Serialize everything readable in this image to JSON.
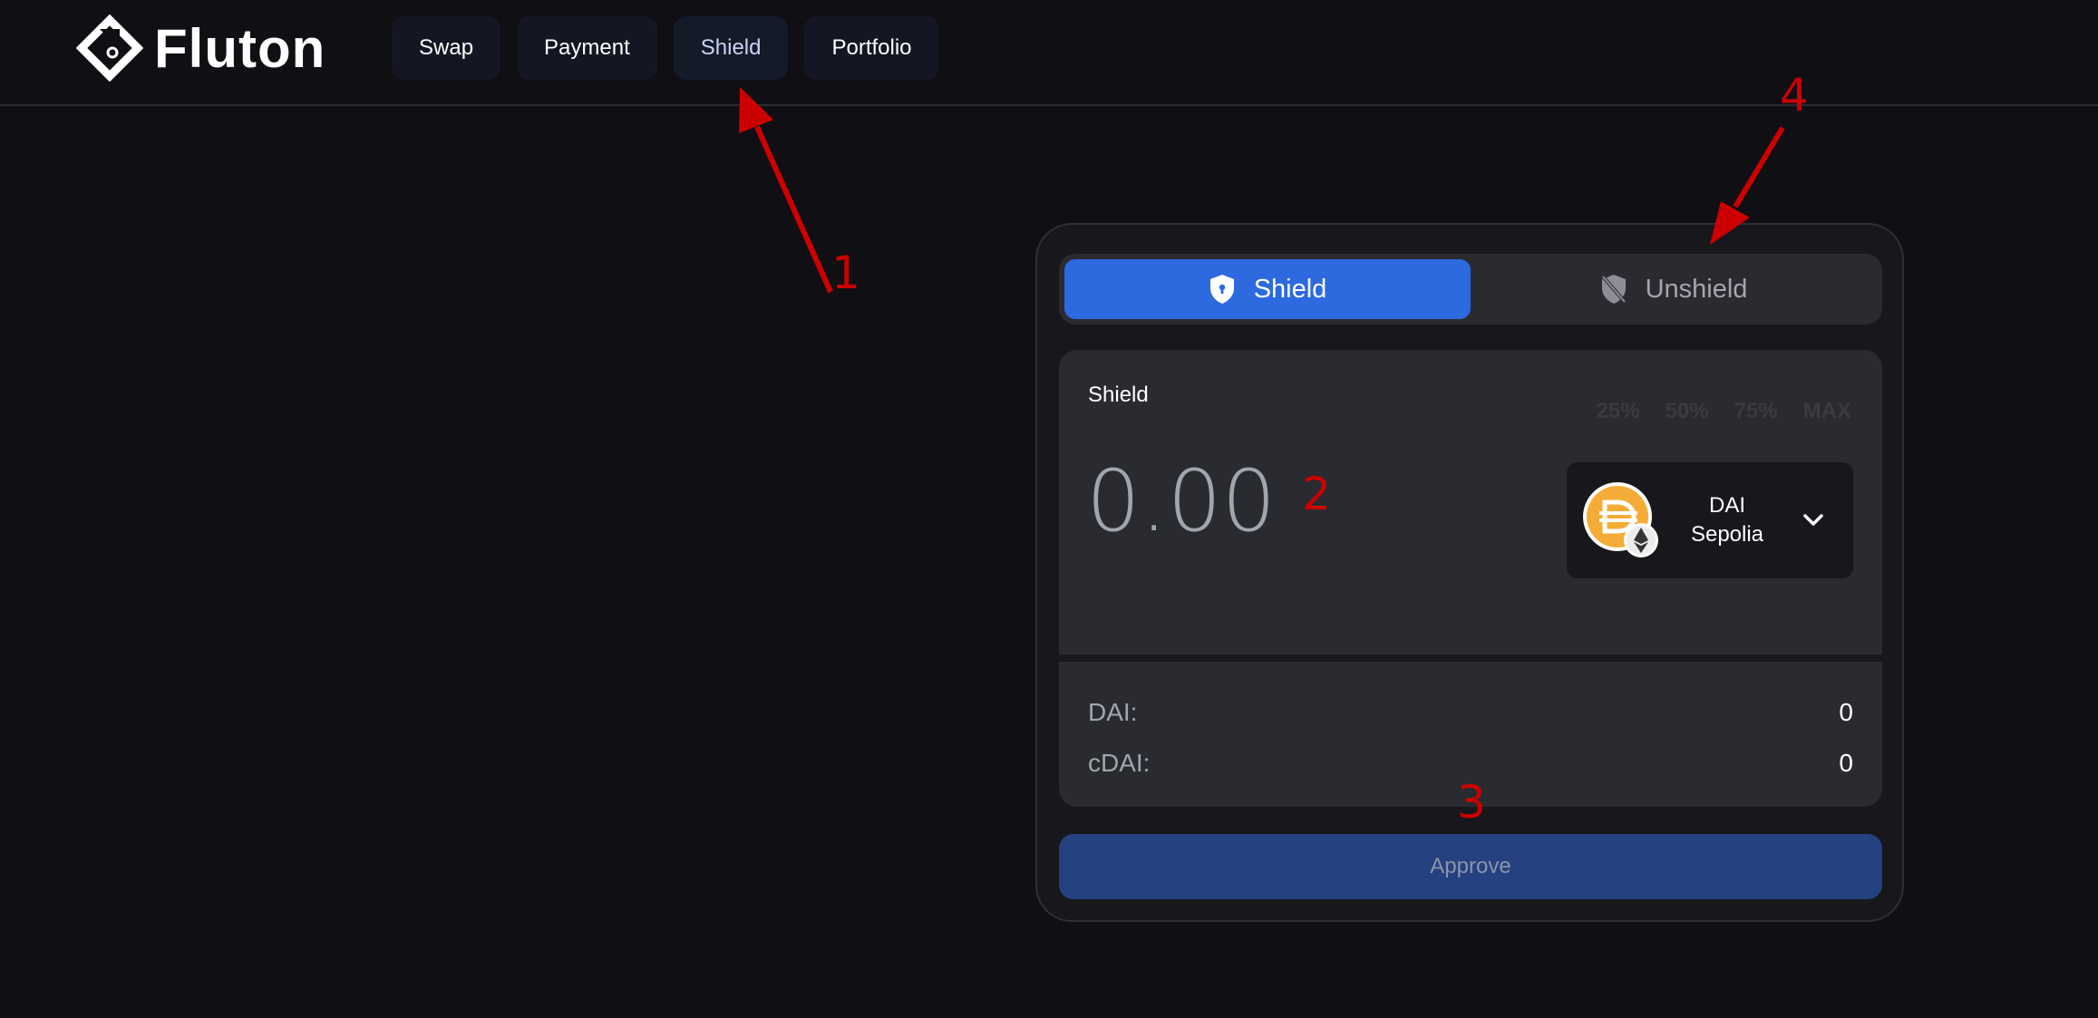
{
  "brand": {
    "name": "Fluton"
  },
  "nav": {
    "items": [
      {
        "label": "Swap"
      },
      {
        "label": "Payment"
      },
      {
        "label": "Shield"
      },
      {
        "label": "Portfolio"
      }
    ],
    "active": "Shield"
  },
  "card": {
    "toggle": {
      "shield_label": "Shield",
      "unshield_label": "Unshield",
      "active": "Shield"
    },
    "input_panel": {
      "label": "Shield",
      "percent_options": [
        "25%",
        "50%",
        "75%",
        "MAX"
      ],
      "amount_placeholder": "0.00",
      "token": {
        "line1": "DAI",
        "line2": "Sepolia"
      }
    },
    "balances": [
      {
        "key": "DAI:",
        "value": "0"
      },
      {
        "key": "cDAI:",
        "value": "0"
      }
    ],
    "approve_label": "Approve"
  },
  "annotations": {
    "n1": "1",
    "n2": "2",
    "n3": "3",
    "n4": "4"
  },
  "colors": {
    "background": "#0f0f14",
    "accent": "#2d6ae0",
    "approve": "#26417f",
    "annotation": "#cc0000",
    "dai_orange": "#f5ac37"
  }
}
